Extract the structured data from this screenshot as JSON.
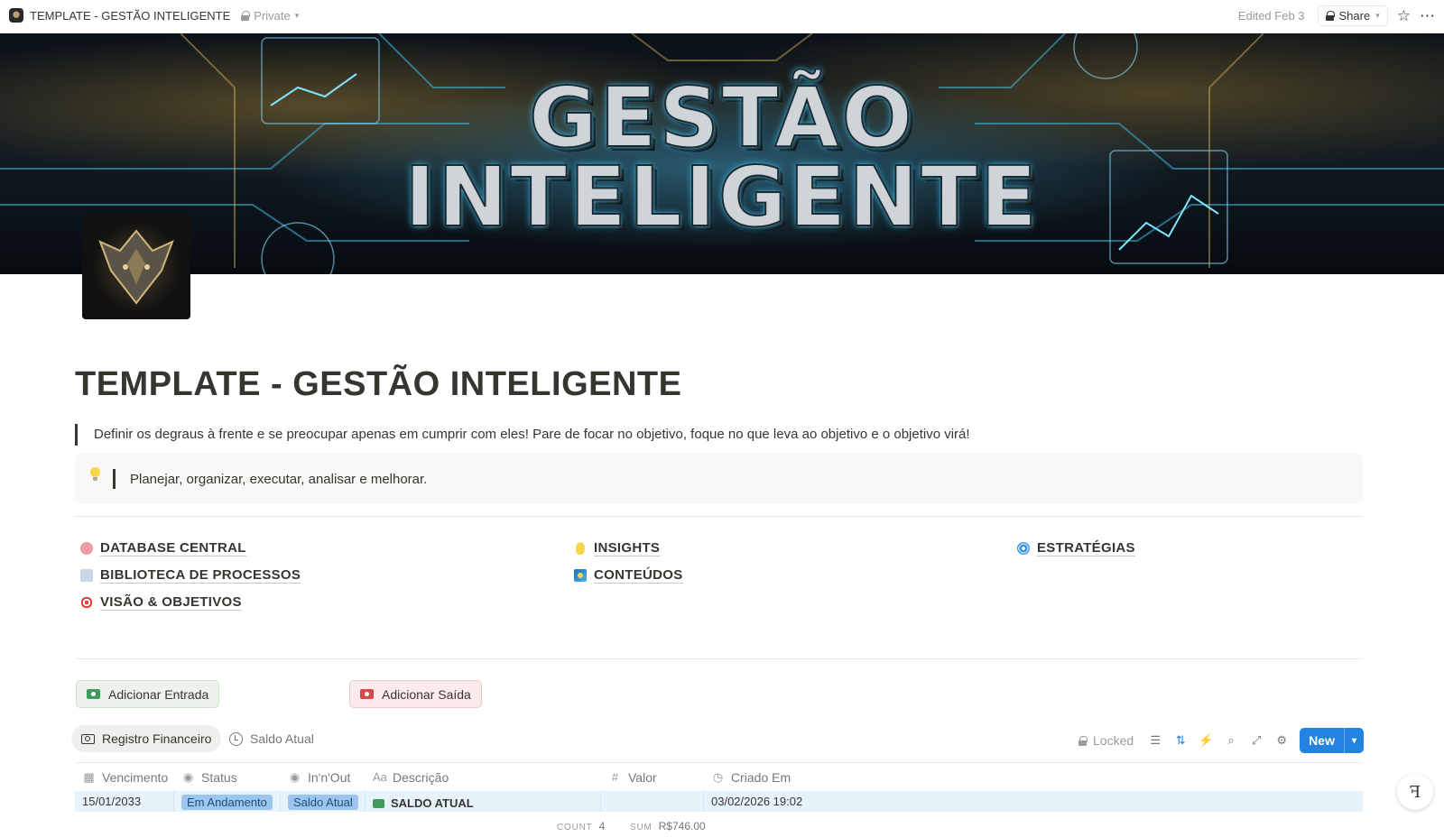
{
  "topbar": {
    "title": "TEMPLATE - GESTÃO INTELIGENTE",
    "privacy": "Private",
    "edited": "Edited Feb 3",
    "share_label": "Share"
  },
  "cover": {
    "line1": "GESTÃO",
    "line2": "INTELIGENTE"
  },
  "page": {
    "title": "TEMPLATE - GESTÃO INTELIGENTE",
    "quote": "Definir os degraus à frente e se preocupar apenas em cumprir com eles! Pare de focar no objetivo, foque no que leva ao objetivo e o objetivo virá!",
    "callout": "Planejar, organizar, executar, analisar e melhorar."
  },
  "links": {
    "col1": [
      "DATABASE CENTRAL",
      "BIBLIOTECA DE PROCESSOS",
      "VISÃO & OBJETIVOS"
    ],
    "col2": [
      "INSIGHTS",
      "CONTEÚDOS"
    ],
    "col3": [
      "ESTRATÉGIAS"
    ]
  },
  "buttons": {
    "add_in": "Adicionar Entrada",
    "add_out": "Adicionar Saída"
  },
  "views": {
    "active": "Registro Financeiro",
    "other": "Saldo Atual"
  },
  "toolbar": {
    "locked": "Locked",
    "new_label": "New"
  },
  "table": {
    "columns": [
      "Vencimento",
      "Status",
      "In'n'Out",
      "Descrição",
      "Valor",
      "Criado Em"
    ],
    "rows": [
      {
        "vencimento": "15/01/2033",
        "status": "Em Andamento",
        "in_out": "Saldo Atual",
        "descricao": "SALDO ATUAL",
        "valor": "",
        "criado_em": "03/02/2026 19:02"
      }
    ]
  },
  "footer": {
    "count_key": "COUNT",
    "count_value": "4",
    "sum_key": "SUM",
    "sum_value": "R$746.00"
  },
  "colors": {
    "accent": "#2383e2",
    "status_pill": "#9ec5ee"
  }
}
